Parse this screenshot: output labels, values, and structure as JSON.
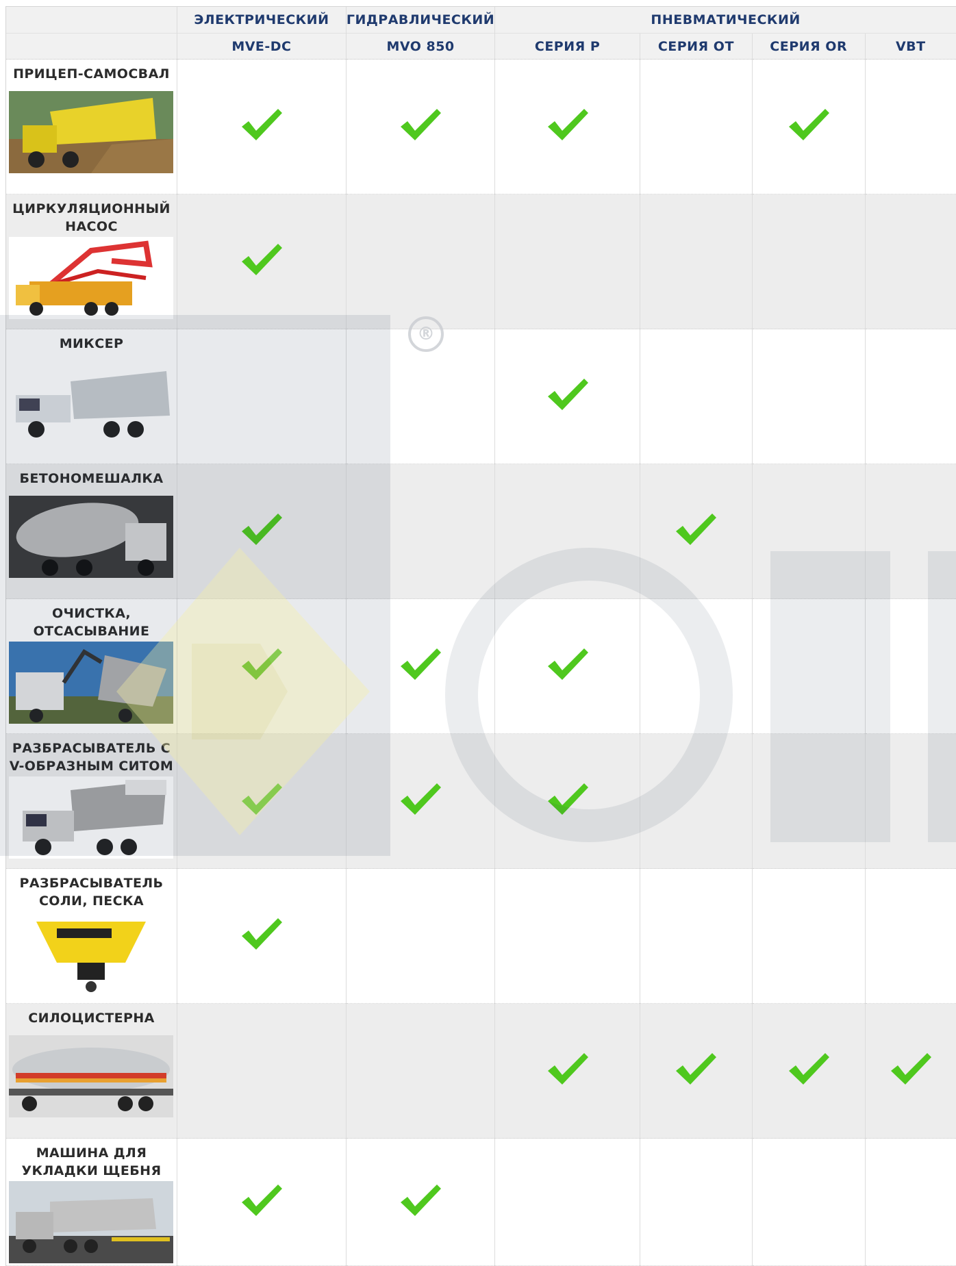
{
  "groups": {
    "electric": "ЭЛЕКТРИЧЕСКИЙ",
    "hydraulic": "ГИДРАВЛИЧЕСКИЙ",
    "pneumatic": "ПНЕВМАТИЧЕСКИЙ"
  },
  "models": [
    "MVE-DC",
    "MVO 850",
    "СЕРИЯ P",
    "СЕРИЯ OT",
    "СЕРИЯ OR",
    "VBT"
  ],
  "applications": [
    {
      "name": "ПРИЦЕП-САМОСВАЛ",
      "supported": [
        true,
        true,
        true,
        false,
        true,
        false
      ]
    },
    {
      "name": "ЦИРКУЛЯЦИОННЫЙ НАСОС",
      "supported": [
        true,
        false,
        false,
        false,
        false,
        false
      ]
    },
    {
      "name": "МИКСЕР",
      "supported": [
        false,
        false,
        true,
        false,
        false,
        false
      ]
    },
    {
      "name": "БЕТОНОМЕШАЛКА",
      "supported": [
        true,
        false,
        false,
        true,
        false,
        false
      ]
    },
    {
      "name": "ОЧИСТКА, ОТСАСЫВАНИЕ",
      "supported": [
        true,
        true,
        true,
        false,
        false,
        false
      ]
    },
    {
      "name": "РАЗБРАСЫВАТЕЛЬ С V-ОБРАЗНЫМ СИТОМ",
      "supported": [
        true,
        true,
        true,
        false,
        false,
        false
      ]
    },
    {
      "name": "РАЗБРАСЫВАТЕЛЬ СОЛИ, ПЕСКА",
      "supported": [
        true,
        false,
        false,
        false,
        false,
        false
      ]
    },
    {
      "name": "СИЛОЦИСТЕРНА",
      "supported": [
        false,
        false,
        true,
        true,
        true,
        true
      ]
    },
    {
      "name": "МАШИНА ДЛЯ УКЛАДКИ ЩЕБНЯ",
      "supported": [
        true,
        true,
        false,
        false,
        false,
        false
      ]
    }
  ],
  "watermark": {
    "reg": "®",
    "text": "OLI"
  },
  "colors": {
    "header_text": "#1f3a6e",
    "check": "#4fc81e",
    "row_alt": "#ededed"
  }
}
